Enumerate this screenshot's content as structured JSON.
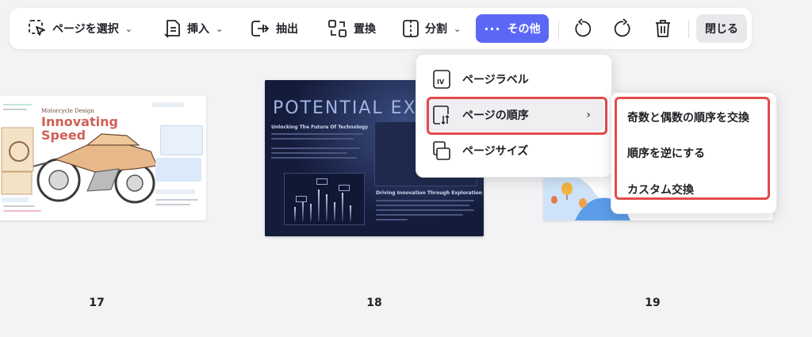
{
  "toolbar": {
    "select_page": "ページを選択",
    "insert": "挿入",
    "extract": "抽出",
    "replace": "置換",
    "split": "分割",
    "more": "その他",
    "close": "閉じる",
    "accent_color": "#5b68f6"
  },
  "more_menu": {
    "items": [
      {
        "label": "ページラベル",
        "icon": "page-label-icon"
      },
      {
        "label": "ページの順序",
        "icon": "page-order-icon",
        "has_submenu": true
      },
      {
        "label": "ページサイズ",
        "icon": "page-size-icon"
      }
    ]
  },
  "order_submenu": {
    "items": [
      {
        "label": "奇数と偶数の順序を交換"
      },
      {
        "label": "順序を逆にする"
      },
      {
        "label": "カスタム交換"
      }
    ]
  },
  "pages": [
    {
      "number": "17",
      "title": "Motorcycle Design",
      "headline_1": "Innovating",
      "headline_2": "Speed"
    },
    {
      "number": "18",
      "title": "POTENTIAL EXPLORA",
      "subtitle": "Unlocking The Future Of Technology",
      "section": "Driving Innovation Through Exploration"
    },
    {
      "number": "19"
    }
  ],
  "highlight_color": "#e24b4b"
}
